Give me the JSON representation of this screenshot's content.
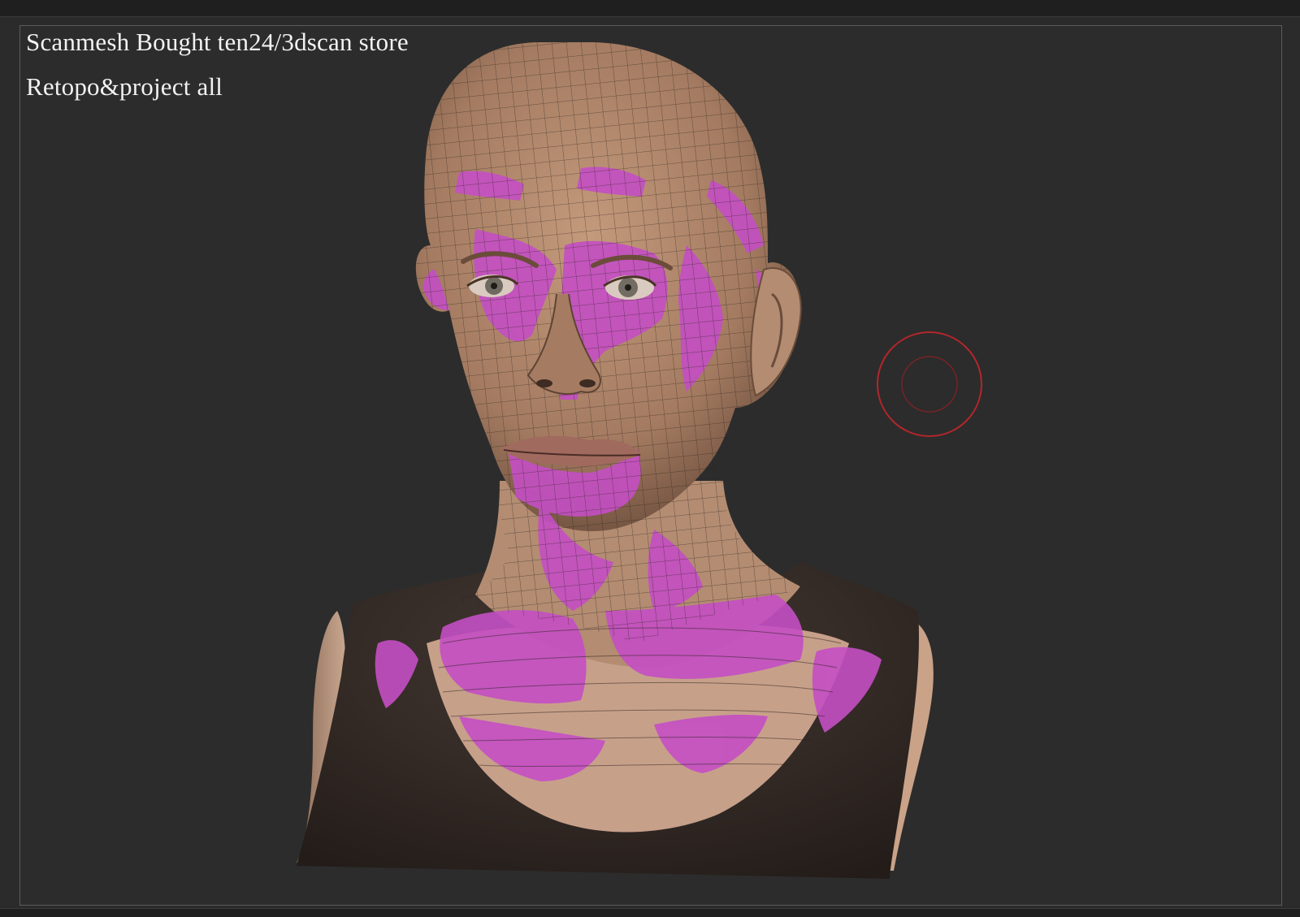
{
  "viewport": {
    "caption_line1": "Scanmesh  Bought  ten24/3dscan store",
    "caption_line2": "Retopo&project all"
  },
  "model": {
    "icon": "3d-head-bust-model",
    "skin_color": "#b08a70",
    "mask_color": "#c44fc4",
    "shirt_color": "#3a302c",
    "wire_color": "#2a211c"
  },
  "cursor": {
    "icon": "brush-radius-cursor",
    "color": "#b3262b"
  }
}
